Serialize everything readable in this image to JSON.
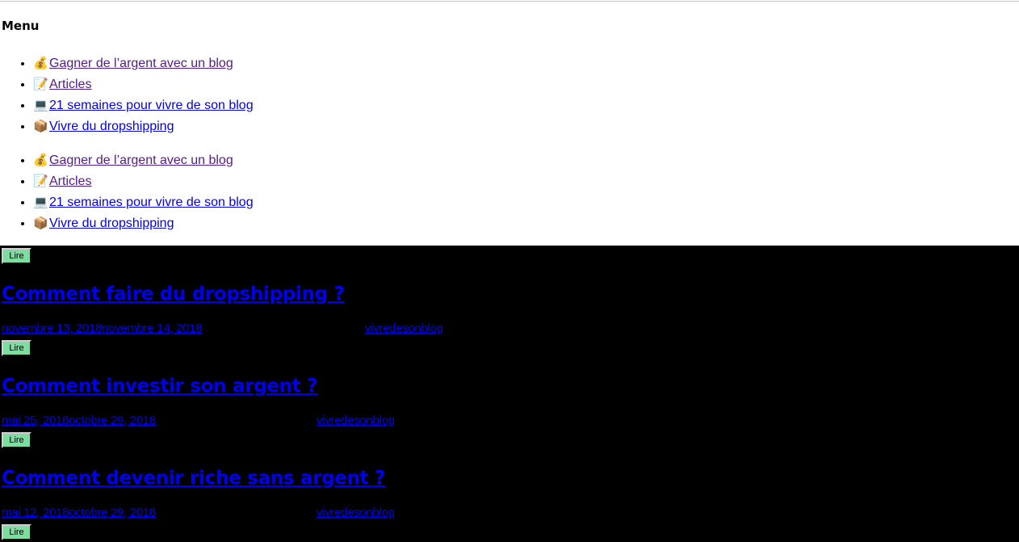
{
  "menu": {
    "title": "Menu",
    "lists": [
      [
        {
          "icon": "money-bag-icon",
          "emoji": "💰",
          "label": "Gagner de l’argent avec un blog",
          "visited": true
        },
        {
          "icon": "memo-icon",
          "emoji": "📝",
          "label": "Articles",
          "visited": true
        },
        {
          "icon": "laptop-icon",
          "emoji": "💻",
          "label": "21 semaines pour vivre de son blog",
          "visited": false
        },
        {
          "icon": "package-icon",
          "emoji": "📦",
          "label": "Vivre du dropshipping",
          "visited": false
        }
      ],
      [
        {
          "icon": "money-bag-icon",
          "emoji": "💰",
          "label": "Gagner de l’argent avec un blog",
          "visited": true
        },
        {
          "icon": "memo-icon",
          "emoji": "📝",
          "label": "Articles",
          "visited": true
        },
        {
          "icon": "laptop-icon",
          "emoji": "💻",
          "label": "21 semaines pour vivre de son blog",
          "visited": false
        },
        {
          "icon": "package-icon",
          "emoji": "📦",
          "label": "Vivre du dropshipping",
          "visited": false
        }
      ]
    ]
  },
  "posts": [
    {
      "button_label": "Lire",
      "title": "Comment faire du dropshipping ?",
      "published": "novembre 13, 2018",
      "updated": "novembre 14, 2018",
      "author": "vivredesonblog"
    },
    {
      "button_label": "Lire",
      "title": "Comment investir son argent ?",
      "published": "mai 25, 2018",
      "updated": "octobre 29, 2018",
      "author": "vivredesonblog"
    },
    {
      "button_label": "Lire",
      "title": "Comment devenir riche sans argent ?",
      "published": "mai 12, 2018",
      "updated": "octobre 29, 2018",
      "author": "vivredesonblog"
    }
  ],
  "next_post": {
    "button_label": "Lire"
  },
  "colors": {
    "link": "#0000ee",
    "visited_link": "#551a8b",
    "posts_background": "#000000",
    "button_background": "#7ddca0"
  }
}
